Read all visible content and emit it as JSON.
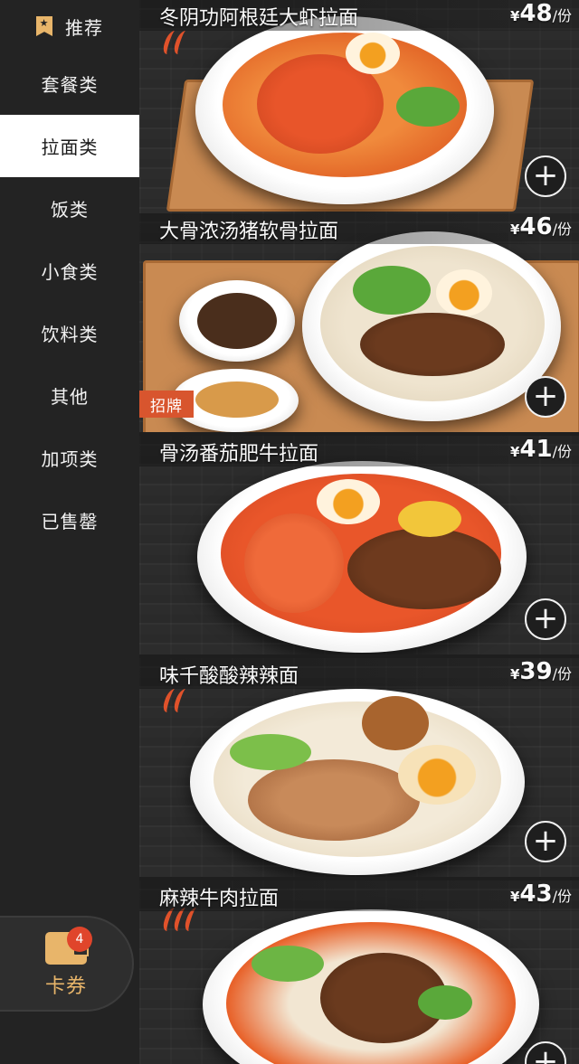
{
  "sidebar": {
    "categories": [
      {
        "label": "推荐"
      },
      {
        "label": "套餐类"
      },
      {
        "label": "拉面类"
      },
      {
        "label": "饭类"
      },
      {
        "label": "小食类"
      },
      {
        "label": "饮料类"
      },
      {
        "label": "其他"
      },
      {
        "label": "加项类"
      },
      {
        "label": "已售罄"
      }
    ],
    "active_index": 2,
    "coupon": {
      "label": "卡券",
      "badge": "4"
    }
  },
  "menu": {
    "items": [
      {
        "name": "冬阴功阿根廷大虾拉面",
        "currency": "¥",
        "price": "48",
        "unit": "/份",
        "tag": ""
      },
      {
        "name": "大骨浓汤猪软骨拉面",
        "currency": "¥",
        "price": "46",
        "unit": "/份",
        "tag": "招牌"
      },
      {
        "name": "骨汤番茄肥牛拉面",
        "currency": "¥",
        "price": "41",
        "unit": "/份",
        "tag": ""
      },
      {
        "name": "味千酸酸辣辣面",
        "currency": "¥",
        "price": "39",
        "unit": "/份",
        "tag": ""
      },
      {
        "name": "麻辣牛肉拉面",
        "currency": "¥",
        "price": "43",
        "unit": "/份",
        "tag": ""
      }
    ],
    "add_label": "+"
  },
  "colors": {
    "accent": "#e8b56a",
    "sidebar_bg": "#232323",
    "active_bg": "#ffffff",
    "badge": "#e0452b",
    "tag": "#d8552e"
  }
}
